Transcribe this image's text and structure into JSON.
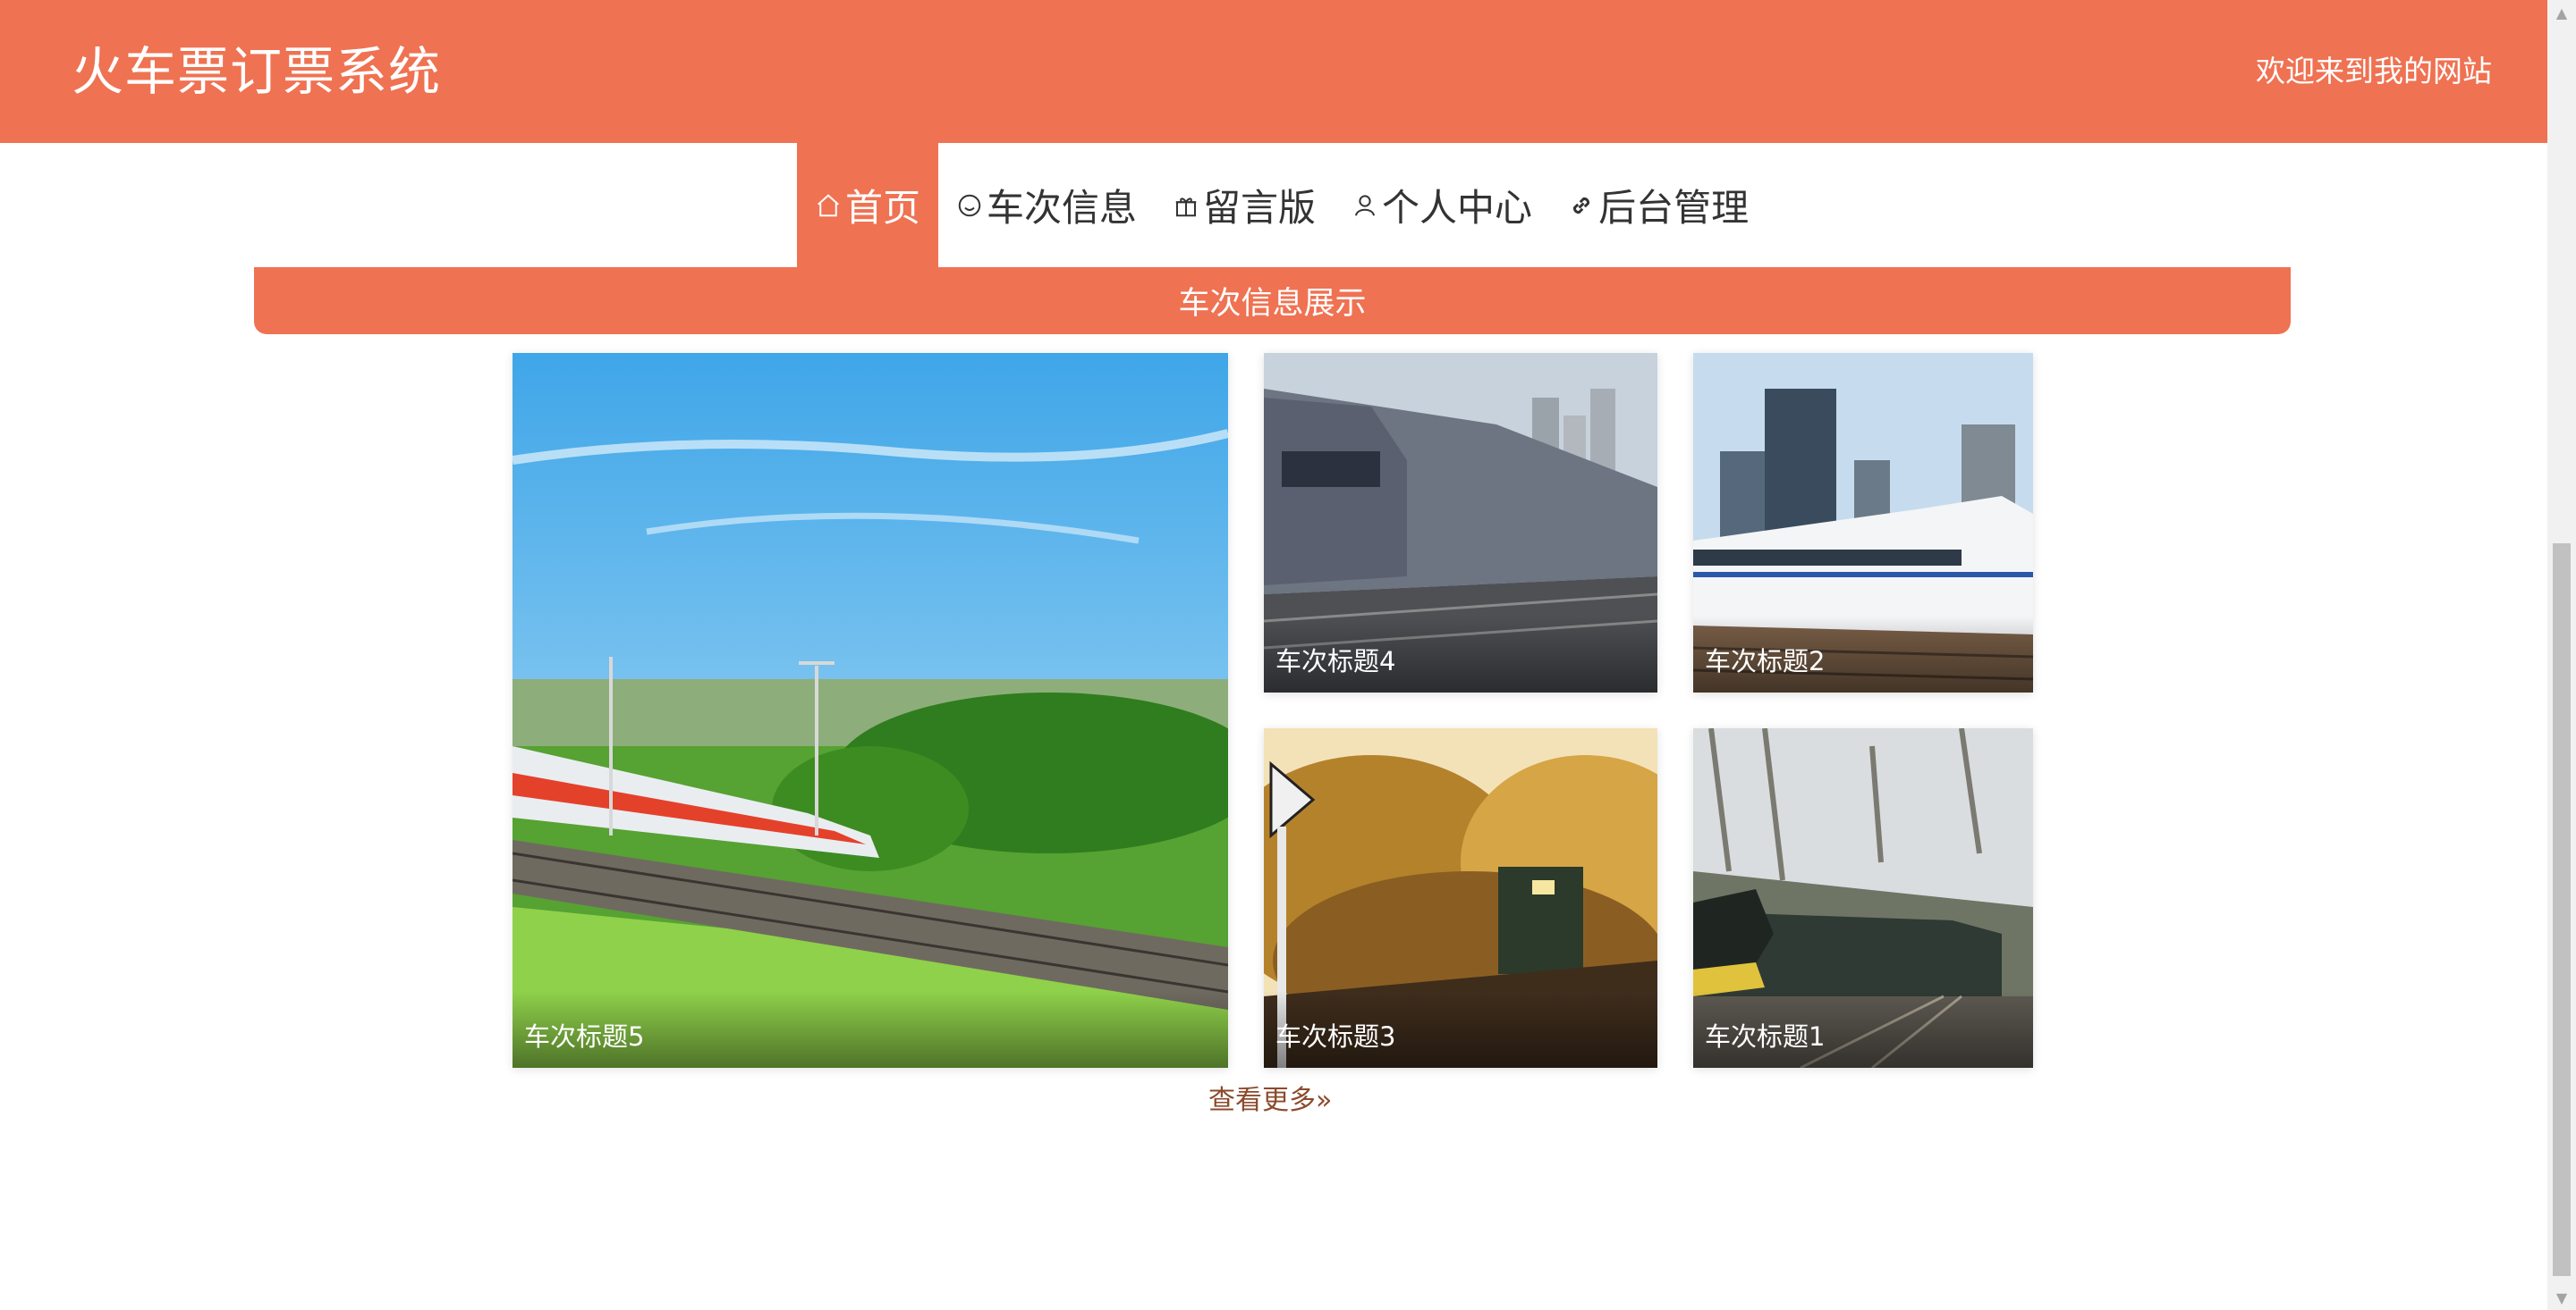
{
  "header": {
    "title": "火车票订票系统",
    "welcome": "欢迎来到我的网站"
  },
  "nav": {
    "items": [
      {
        "label": "首页",
        "icon": "home-icon",
        "active": true
      },
      {
        "label": "车次信息",
        "icon": "smile-icon"
      },
      {
        "label": "留言版",
        "icon": "gift-icon"
      },
      {
        "label": "个人中心",
        "icon": "user-icon"
      },
      {
        "label": "后台管理",
        "icon": "link-icon"
      }
    ]
  },
  "section": {
    "title": "车次信息展示"
  },
  "trains": [
    {
      "caption": "车次标题5"
    },
    {
      "caption": "车次标题4"
    },
    {
      "caption": "车次标题2"
    },
    {
      "caption": "车次标题3"
    },
    {
      "caption": "车次标题1"
    }
  ],
  "more": {
    "label": "查看更多",
    "icon": "double-chevron-right-icon"
  },
  "colors": {
    "accent": "#ef7252",
    "more_link": "#8b4a2b"
  }
}
